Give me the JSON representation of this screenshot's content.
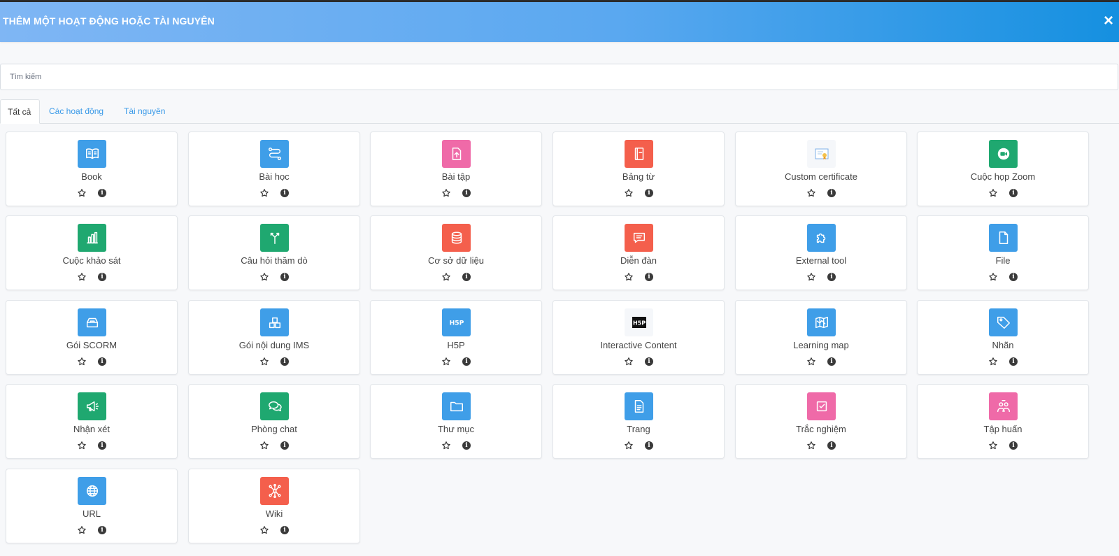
{
  "modal": {
    "title": "THÊM MỘT HOẠT ĐỘNG HOẶC TÀI NGUYÊN",
    "close_glyph": "×"
  },
  "search": {
    "placeholder": "Tìm kiếm"
  },
  "tabs": [
    {
      "label": "Tất cả",
      "active": true
    },
    {
      "label": "Các hoạt động",
      "active": false
    },
    {
      "label": "Tài nguyên",
      "active": false
    }
  ],
  "activities": [
    {
      "label": "Book",
      "icon": "book-icon",
      "color": "#3f9ee8"
    },
    {
      "label": "Bài học",
      "icon": "lesson-icon",
      "color": "#3f9ee8"
    },
    {
      "label": "Bài tập",
      "icon": "assignment-icon",
      "color": "#ef6aa8"
    },
    {
      "label": "Bảng từ",
      "icon": "glossary-icon",
      "color": "#f45f4c"
    },
    {
      "label": "Custom certificate",
      "icon": "certificate-icon",
      "color": "#f5f7fa"
    },
    {
      "label": "Cuộc họp Zoom",
      "icon": "zoom-icon",
      "color": "#1fa870"
    },
    {
      "label": "Cuộc khảo sát",
      "icon": "survey-icon",
      "color": "#1fa870"
    },
    {
      "label": "Câu hỏi thăm dò",
      "icon": "choice-icon",
      "color": "#1fa870"
    },
    {
      "label": "Cơ sở dữ liệu",
      "icon": "database-icon",
      "color": "#f45f4c"
    },
    {
      "label": "Diễn đàn",
      "icon": "forum-icon",
      "color": "#f45f4c"
    },
    {
      "label": "External tool",
      "icon": "puzzle-icon",
      "color": "#3f9ee8"
    },
    {
      "label": "File",
      "icon": "file-icon",
      "color": "#3f9ee8"
    },
    {
      "label": "Gói SCORM",
      "icon": "scorm-icon",
      "color": "#3f9ee8"
    },
    {
      "label": "Gói nội dung IMS",
      "icon": "ims-icon",
      "color": "#3f9ee8"
    },
    {
      "label": "H5P",
      "icon": "h5p-icon",
      "color": "#3f9ee8"
    },
    {
      "label": "Interactive Content",
      "icon": "h5p-black-icon",
      "color": "#f5f7fa"
    },
    {
      "label": "Learning map",
      "icon": "map-icon",
      "color": "#3f9ee8"
    },
    {
      "label": "Nhãn",
      "icon": "label-tag-icon",
      "color": "#3f9ee8"
    },
    {
      "label": "Nhận xét",
      "icon": "feedback-megaphone-icon",
      "color": "#1fa870"
    },
    {
      "label": "Phòng chat",
      "icon": "chat-icon",
      "color": "#1fa870"
    },
    {
      "label": "Thư mục",
      "icon": "folder-icon",
      "color": "#3f9ee8"
    },
    {
      "label": "Trang",
      "icon": "page-icon",
      "color": "#3f9ee8"
    },
    {
      "label": "Trắc nghiệm",
      "icon": "quiz-icon",
      "color": "#ef6aa8"
    },
    {
      "label": "Tập huấn",
      "icon": "workshop-icon",
      "color": "#ef6aa8"
    },
    {
      "label": "URL",
      "icon": "globe-icon",
      "color": "#3f9ee8"
    },
    {
      "label": "Wiki",
      "icon": "wiki-icon",
      "color": "#f45f4c"
    }
  ]
}
